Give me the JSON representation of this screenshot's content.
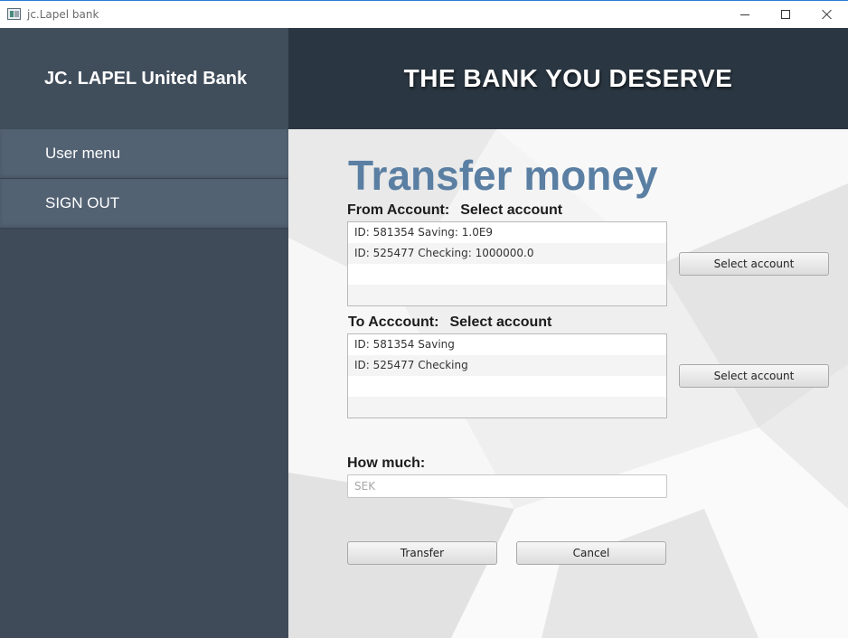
{
  "window": {
    "title": "jc.Lapel bank"
  },
  "sidebar": {
    "brand": "JC. LAPEL United Bank",
    "items": [
      {
        "label": "User menu"
      },
      {
        "label": "SIGN OUT"
      }
    ]
  },
  "header": {
    "tagline": "THE BANK YOU DESERVE"
  },
  "main": {
    "title": "Transfer money",
    "from": {
      "label": "From Account:",
      "selected": "Select account",
      "rows": [
        "ID: 581354 Saving: 1.0E9",
        "ID: 525477 Checking: 1000000.0"
      ],
      "button": "Select account"
    },
    "to": {
      "label": "To Acccount:",
      "selected": "Select account",
      "rows": [
        "ID: 581354 Saving",
        "ID: 525477 Checking"
      ],
      "button": "Select account"
    },
    "amount": {
      "label": "How much:",
      "placeholder": "SEK",
      "value": ""
    },
    "transfer_button": "Transfer",
    "cancel_button": "Cancel"
  },
  "colors": {
    "sidebar_bg": "#3f4b59",
    "nav_item_bg": "#536273",
    "header_bg": "#2a3641",
    "title_accent": "#5a7fa3"
  }
}
